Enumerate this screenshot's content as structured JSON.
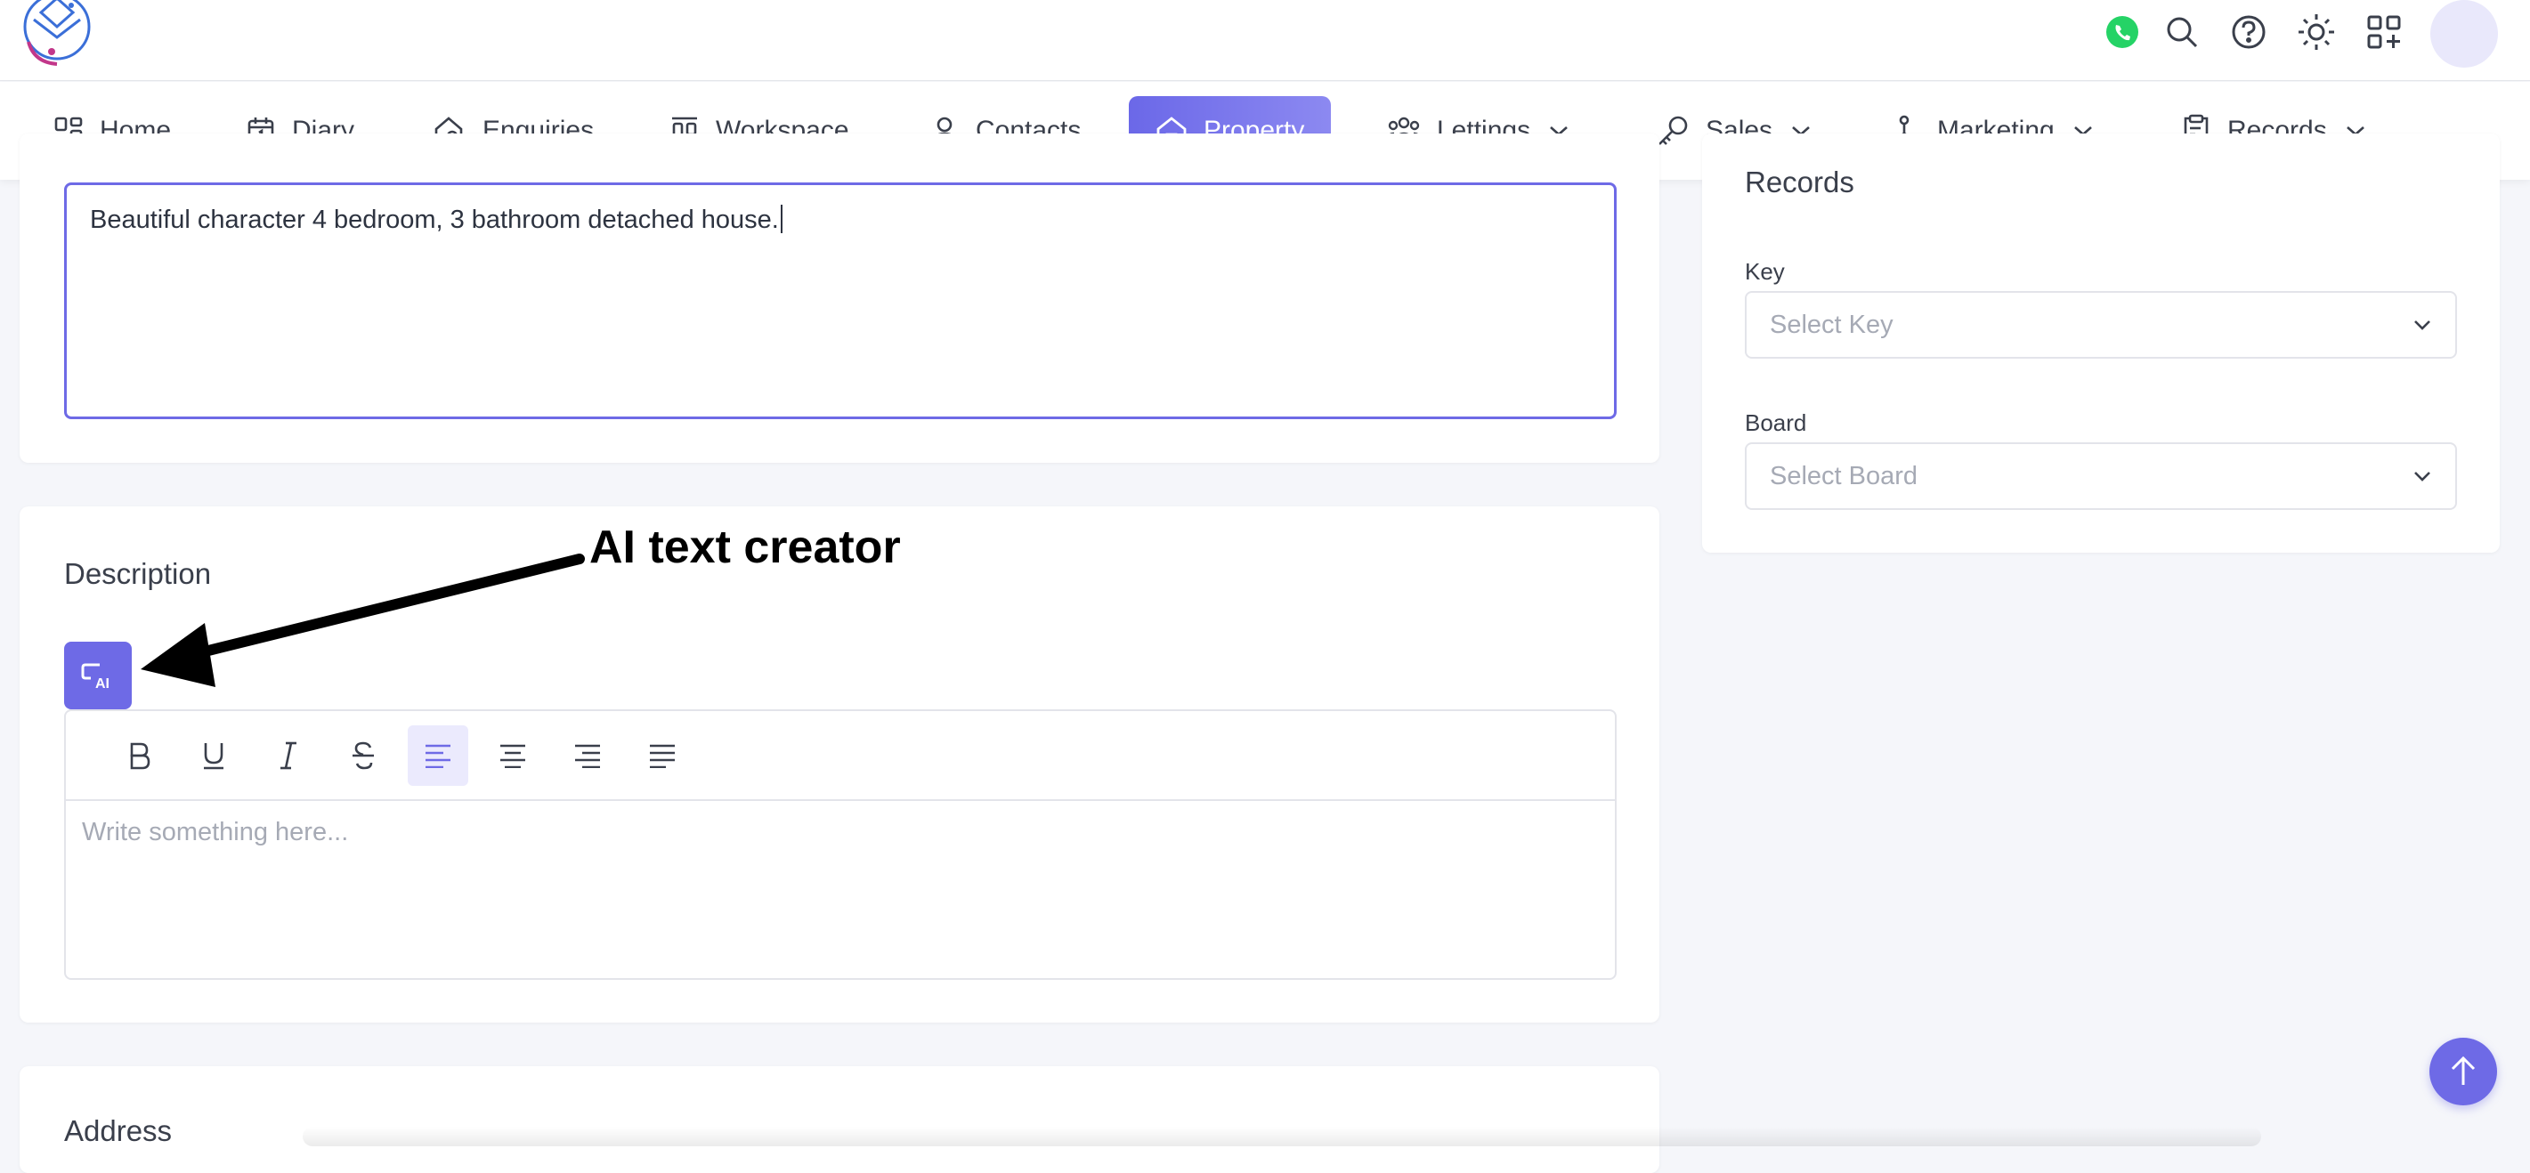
{
  "nav": {
    "items": [
      {
        "label": "Home",
        "icon": "grid-icon"
      },
      {
        "label": "Diary",
        "icon": "calendar-icon"
      },
      {
        "label": "Enquiries",
        "icon": "house-search-icon"
      },
      {
        "label": "Workspace",
        "icon": "workspace-icon"
      },
      {
        "label": "Contacts",
        "icon": "person-icon"
      },
      {
        "label": "Property",
        "icon": "house-icon",
        "active": true
      },
      {
        "label": "Lettings",
        "icon": "people-icon",
        "dropdown": true
      },
      {
        "label": "Sales",
        "icon": "key-icon",
        "dropdown": true
      },
      {
        "label": "Marketing",
        "icon": "network-icon",
        "dropdown": true
      },
      {
        "label": "Records",
        "icon": "clipboard-icon",
        "dropdown": true
      }
    ]
  },
  "topbar": {
    "icons": [
      "whatsapp-icon",
      "search-icon",
      "help-icon",
      "sun-icon",
      "apps-icon"
    ]
  },
  "summary": {
    "text": "Beautiful character 4 bedroom, 3 bathroom detached house."
  },
  "description": {
    "title": "Description",
    "ai_label": "AI",
    "placeholder": "Write something here..."
  },
  "annotation": {
    "text": "AI text creator"
  },
  "address": {
    "title": "Address"
  },
  "records": {
    "title": "Records",
    "key_label": "Key",
    "key_placeholder": "Select Key",
    "board_label": "Board",
    "board_placeholder": "Select Board"
  },
  "colors": {
    "accent": "#6e6ae6",
    "whatsapp": "#25d366"
  }
}
